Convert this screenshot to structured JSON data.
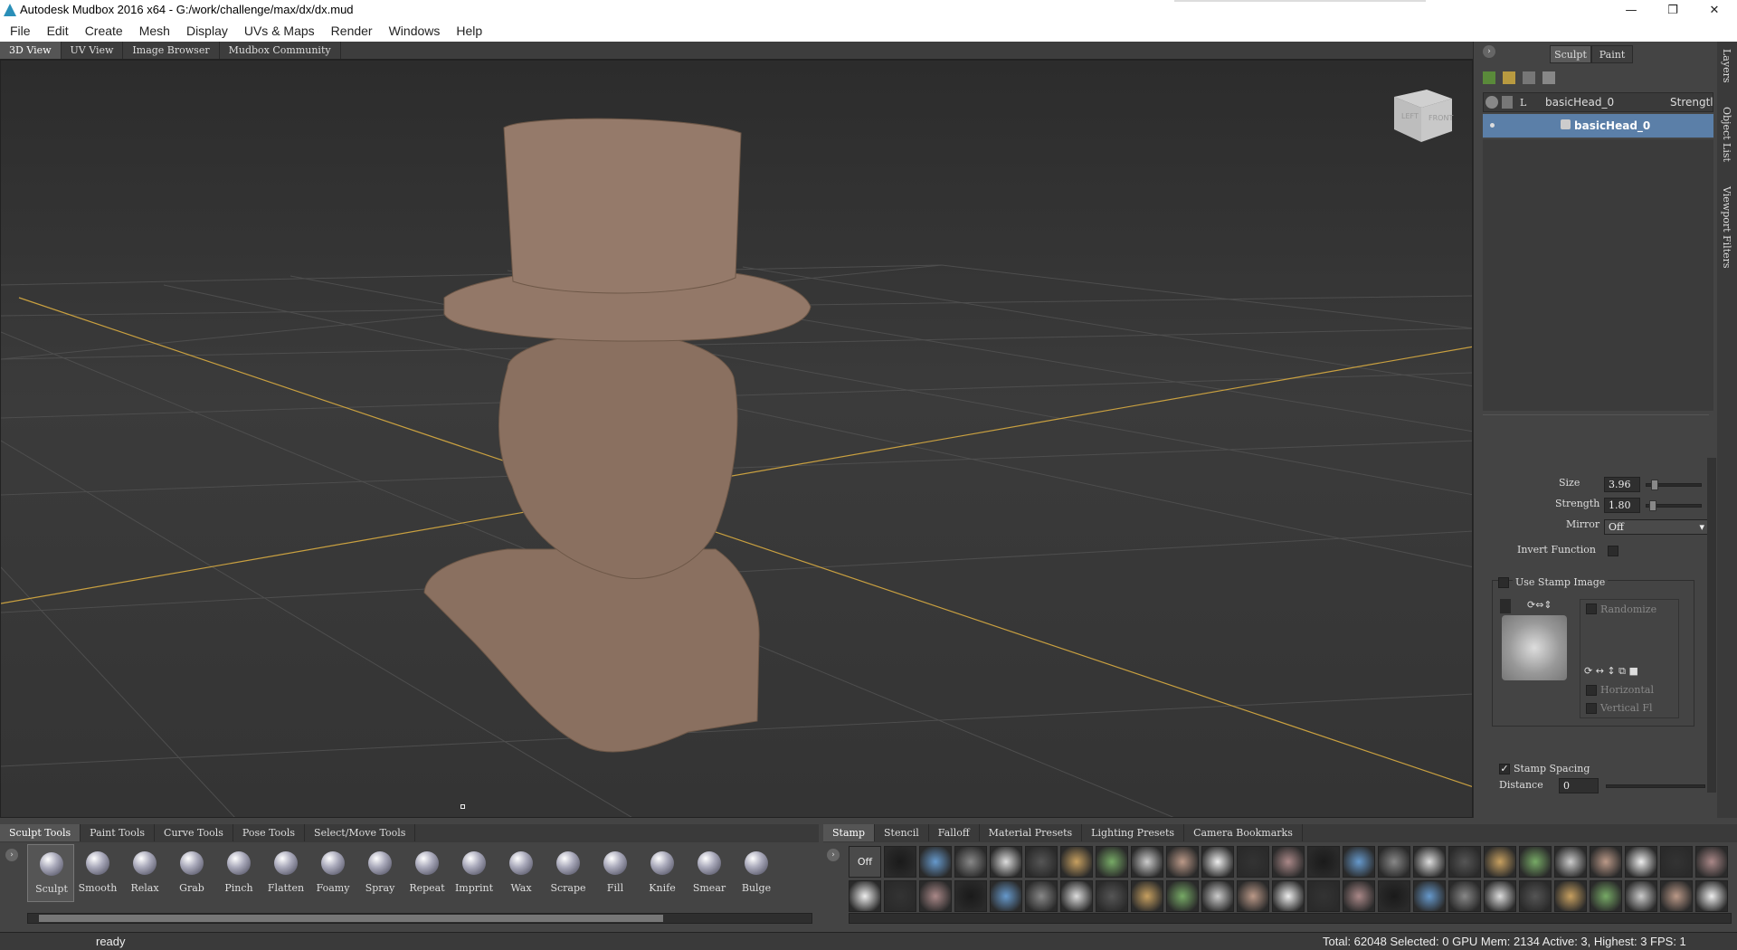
{
  "window": {
    "title": "Autodesk Mudbox 2016 x64 - G:/work/challenge/max/dx/dx.mud",
    "controls": {
      "minimize": "—",
      "maximize": "❐",
      "close": "✕"
    }
  },
  "menubar": [
    "File",
    "Edit",
    "Create",
    "Mesh",
    "Display",
    "UVs & Maps",
    "Render",
    "Windows",
    "Help"
  ],
  "viewport_tabs": [
    "3D View",
    "UV View",
    "Image Browser",
    "Mudbox Community"
  ],
  "viewcube": {
    "left": "LEFT",
    "front": "FRONT"
  },
  "right_panel": {
    "mode_tabs": [
      "Sculpt",
      "Paint"
    ],
    "side_tabs": [
      "Layers",
      "Object List",
      "Viewport Filters"
    ],
    "layers_header": {
      "lock_col": "L",
      "name": "basicHead_0",
      "strength": "Strengtl"
    },
    "layer_row": "basicHead_0",
    "properties": {
      "size_label": "Size",
      "size_value": "3.96",
      "strength_label": "Strength",
      "strength_value": "1.80",
      "mirror_label": "Mirror",
      "mirror_value": "Off",
      "invert_label": "Invert Function",
      "use_stamp_label": "Use Stamp Image",
      "randomize_label": "Randomize",
      "horizontal_label": "Horizontal",
      "vertical_label": "Vertical Fl",
      "stamp_spacing_label": "Stamp Spacing",
      "distance_label": "Distance",
      "distance_value": "0"
    }
  },
  "tool_tabs": [
    "Sculpt Tools",
    "Paint Tools",
    "Curve Tools",
    "Pose Tools",
    "Select/Move Tools"
  ],
  "tools": [
    "Sculpt",
    "Smooth",
    "Relax",
    "Grab",
    "Pinch",
    "Flatten",
    "Foamy",
    "Spray",
    "Repeat",
    "Imprint",
    "Wax",
    "Scrape",
    "Fill",
    "Knife",
    "Smear",
    "Bulge"
  ],
  "tray_tabs": [
    "Stamp",
    "Stencil",
    "Falloff",
    "Material Presets",
    "Lighting Presets",
    "Camera Bookmarks"
  ],
  "stamp_off_label": "Off",
  "statusbar": {
    "left": "ready",
    "right": "Total: 62048  Selected: 0 GPU Mem: 2134  Active: 3, Highest: 3  FPS: 1"
  },
  "colors": {
    "accent_selection": "#5b7fa8",
    "grid_axis": "#c9a040",
    "model": "#8a7060"
  }
}
